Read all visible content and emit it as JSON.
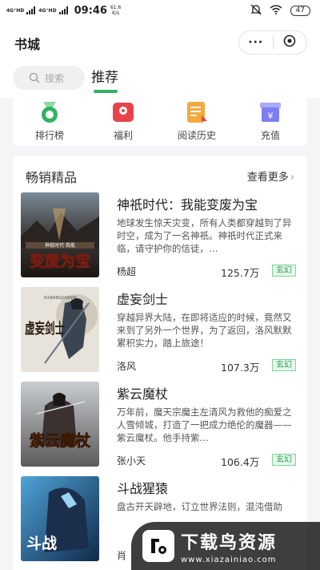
{
  "status_bar": {
    "network_1": "4G⁺HD",
    "network_2": "4G⁺HD",
    "time": "09:46",
    "speed_value": "61.6",
    "speed_unit": "K/s",
    "battery": "47"
  },
  "header": {
    "title": "书城",
    "more_label": "···"
  },
  "tabs": {
    "search_placeholder": "搜索",
    "recommend_label": "推荐"
  },
  "quick_menu": [
    {
      "label": "排行榜",
      "icon": "medal-icon",
      "color": "#2fb361"
    },
    {
      "label": "福利",
      "icon": "gift-icon",
      "color": "#e8434a"
    },
    {
      "label": "阅读历史",
      "icon": "history-icon",
      "color": "#f2a93b"
    },
    {
      "label": "充值",
      "icon": "recharge-icon",
      "color": "#7b7ff0"
    }
  ],
  "section": {
    "title": "畅销精品",
    "more_label": "查看更多",
    "more_chevron": "›"
  },
  "books": [
    {
      "title": "神祇时代：我能变废为宝",
      "desc": "地球发生惊天灾变，所有人类都穿越到了异时空，成为了一名神祇。神祇时代正式来临，请守护你的信徒，…",
      "author": "杨超",
      "count": "125.7万",
      "tag": "玄幻",
      "cover_text": "变废为宝",
      "cover_sub": "神祇时代·我能"
    },
    {
      "title": "虚妄剑士",
      "desc": "穿越异界大陆，在即将适应的时候，竟然又来到了另外一个世界，为了返回，洛风默默累积实力，踏上旅途！",
      "author": "洛风",
      "count": "107.3万",
      "tag": "玄幻",
      "cover_text": "虚妄剑士",
      "cover_sub": "XUWANGJIANSHI"
    },
    {
      "title": "紫云魔杖",
      "desc": "万年前，魔天宗魔主左清风为救他的痴爱之人雪倾城，打造了一把成力绝伦的魔器——紫云魔杖。他手持紫…",
      "author": "张小天",
      "count": "106.4万",
      "tag": "玄幻",
      "cover_text": "紫云魔杖",
      "cover_sub": ""
    },
    {
      "title": "斗战猩猿",
      "desc": "盘古开天辟地，订立世界法则，混沌借助",
      "author": "肖",
      "count": "",
      "tag": "",
      "cover_text": "斗战",
      "cover_sub": ""
    }
  ],
  "watermark": {
    "brand": "下载鸟资源",
    "url": "www.xiazainiao.com"
  },
  "colors": {
    "accent": "#2fb361",
    "background": "#f4f5f7"
  }
}
